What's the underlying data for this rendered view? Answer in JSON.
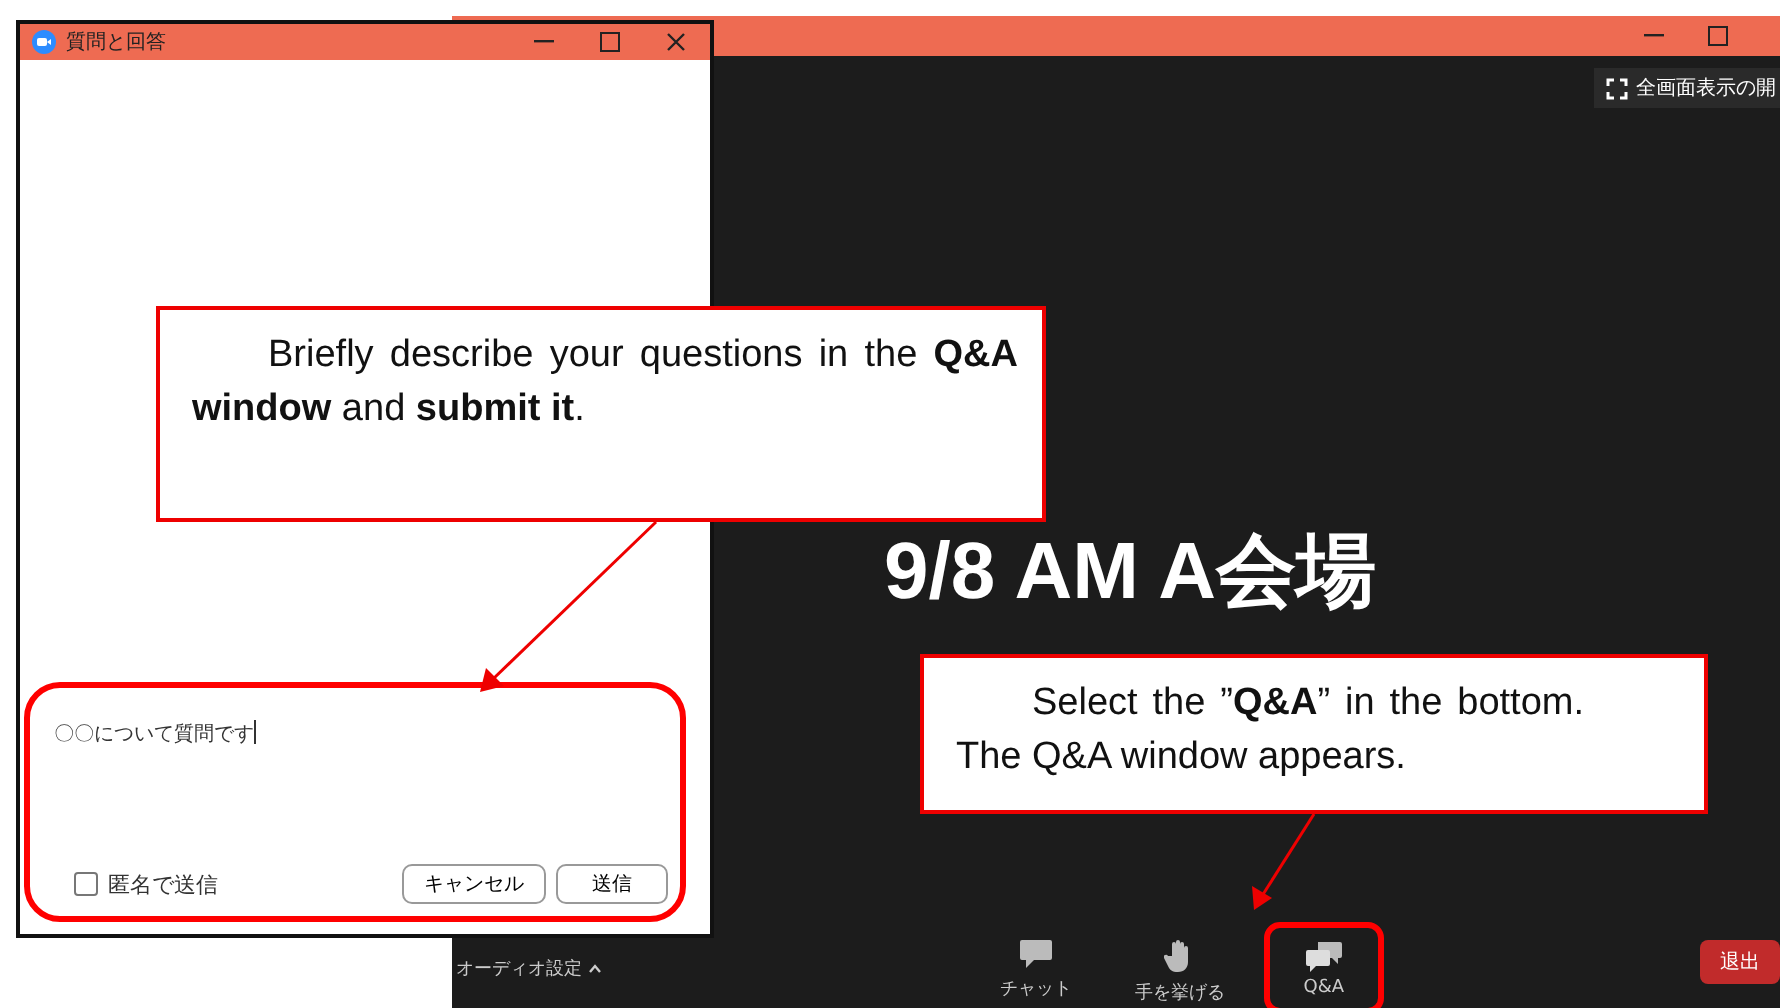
{
  "meeting_window": {
    "fullscreen_button": "全画面表示の開",
    "slide_title": "9/8 AM A会場",
    "audio_settings": "オーディオ設定",
    "toolbar": [
      {
        "kind": "chat",
        "label": "チャット",
        "highlighted": false
      },
      {
        "kind": "hand",
        "label": "手を挙げる",
        "highlighted": false
      },
      {
        "kind": "qa",
        "label": "Q&A",
        "highlighted": true
      }
    ],
    "leave_button": "退出"
  },
  "qa_window": {
    "title": "質問と回答",
    "question": {
      "value": "〇〇について質問です"
    },
    "anonymous": {
      "label": "匿名で送信",
      "checked": false
    },
    "buttons": [
      "キャンセル",
      "送信"
    ],
    "highlighted": true
  },
  "callouts": [
    {
      "text": "Briefly describe your questions in the **Q&A window** and **submit it**."
    },
    {
      "text": "Select the ”**Q&A**” in the bottom. The Q&A window appears."
    }
  ]
}
